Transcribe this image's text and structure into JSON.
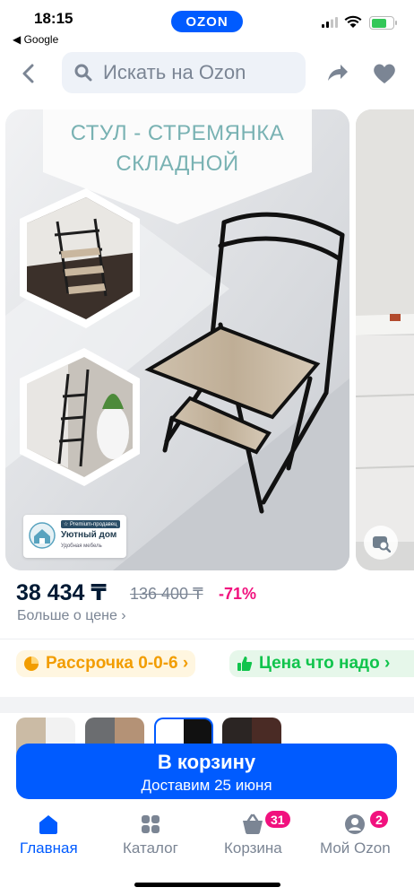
{
  "status_bar": {
    "time": "18:15",
    "back_app": "◀ Google",
    "app_pill": "OZON"
  },
  "header": {
    "search_placeholder": "Искать на Ozon",
    "back_icon": "chevron-left-icon",
    "share_icon": "share-icon",
    "favorite_icon": "heart-icon"
  },
  "gallery": {
    "banner_line1": "СТУЛ - СТРЕМЯНКА",
    "banner_line2": "СКЛАДНОЙ",
    "seller_premium": "☆ Premium-продавец",
    "seller_name": "Уютный дом",
    "seller_tagline": "Удобная мебель"
  },
  "price": {
    "current": "38 434 ₸",
    "old": "136 400 ₸",
    "discount": "-71%",
    "more_link": "Больше о цене ›"
  },
  "chips": {
    "installment": "Рассрочка 0-0-6 ›",
    "fair_price": "Цена что надо ›"
  },
  "cart_button": {
    "title": "В корзину",
    "subtitle": "Доставим 25 июня"
  },
  "bottom_nav": {
    "items": [
      {
        "label": "Главная",
        "icon": "home-icon",
        "active": true
      },
      {
        "label": "Каталог",
        "icon": "grid-icon"
      },
      {
        "label": "Корзина",
        "icon": "cart-icon",
        "badge": "31"
      },
      {
        "label": "Мой Ozon",
        "icon": "profile-icon",
        "badge": "2"
      }
    ]
  },
  "colors": {
    "accent": "#005bff",
    "discount": "#f1117e",
    "installment": "#f29d00",
    "fair_price": "#10c44c"
  }
}
